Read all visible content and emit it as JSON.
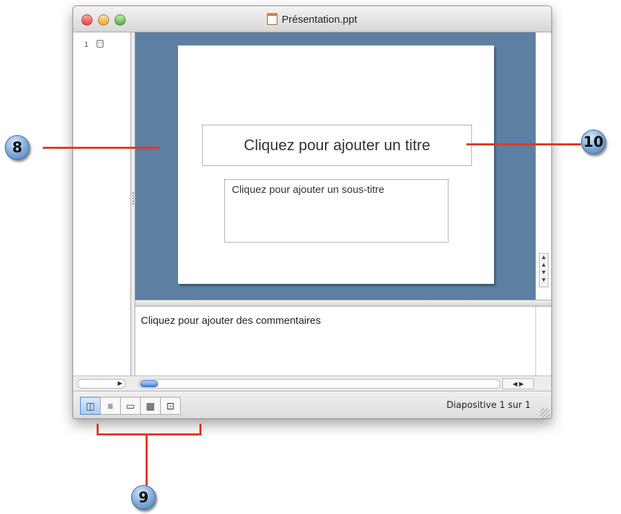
{
  "window": {
    "title": "Présentation.ppt"
  },
  "thumbnails": {
    "slide_number": "1"
  },
  "slide": {
    "title_placeholder": "Cliquez pour ajouter un titre",
    "subtitle_placeholder": "Cliquez pour ajouter un sous-titre"
  },
  "notes": {
    "placeholder": "Cliquez pour ajouter des commentaires"
  },
  "status": {
    "text": "Diapositive 1 sur 1"
  },
  "view_buttons": [
    {
      "name": "normal-view",
      "icon": "normal-view-icon",
      "active": true
    },
    {
      "name": "outline-view",
      "icon": "outline-view-icon",
      "active": false
    },
    {
      "name": "slide-view",
      "icon": "slide-view-icon",
      "active": false
    },
    {
      "name": "slide-sorter-view",
      "icon": "slide-sorter-icon",
      "active": false
    },
    {
      "name": "slide-show-view",
      "icon": "slide-show-icon",
      "active": false
    }
  ],
  "callouts": {
    "left": "8",
    "bottom": "9",
    "right": "10"
  },
  "colors": {
    "slide_background": "#5d7fa2",
    "callout_line": "#e03a1f",
    "callout_badge": "#7fa8d8"
  }
}
